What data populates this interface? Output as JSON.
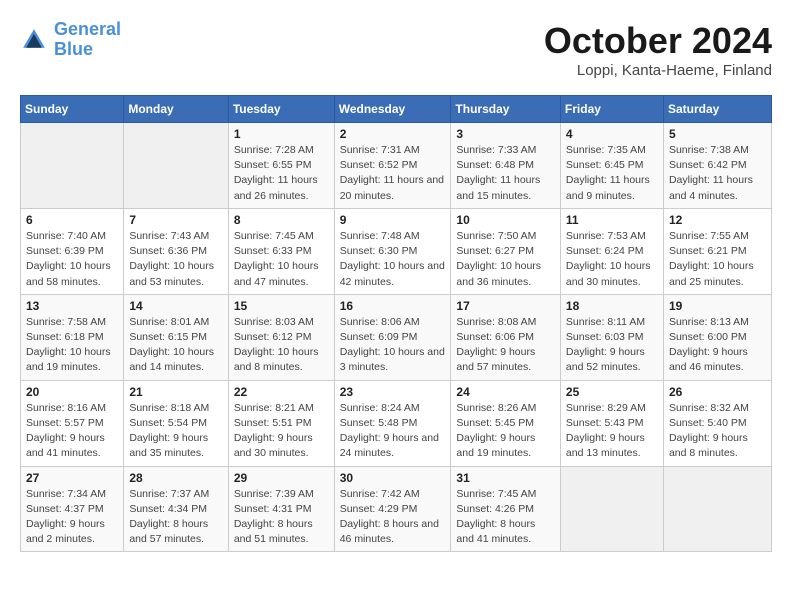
{
  "header": {
    "logo_line1": "General",
    "logo_line2": "Blue",
    "month": "October 2024",
    "location": "Loppi, Kanta-Haeme, Finland"
  },
  "weekdays": [
    "Sunday",
    "Monday",
    "Tuesday",
    "Wednesday",
    "Thursday",
    "Friday",
    "Saturday"
  ],
  "weeks": [
    [
      {
        "day": "",
        "detail": ""
      },
      {
        "day": "",
        "detail": ""
      },
      {
        "day": "1",
        "detail": "Sunrise: 7:28 AM\nSunset: 6:55 PM\nDaylight: 11 hours and 26 minutes."
      },
      {
        "day": "2",
        "detail": "Sunrise: 7:31 AM\nSunset: 6:52 PM\nDaylight: 11 hours and 20 minutes."
      },
      {
        "day": "3",
        "detail": "Sunrise: 7:33 AM\nSunset: 6:48 PM\nDaylight: 11 hours and 15 minutes."
      },
      {
        "day": "4",
        "detail": "Sunrise: 7:35 AM\nSunset: 6:45 PM\nDaylight: 11 hours and 9 minutes."
      },
      {
        "day": "5",
        "detail": "Sunrise: 7:38 AM\nSunset: 6:42 PM\nDaylight: 11 hours and 4 minutes."
      }
    ],
    [
      {
        "day": "6",
        "detail": "Sunrise: 7:40 AM\nSunset: 6:39 PM\nDaylight: 10 hours and 58 minutes."
      },
      {
        "day": "7",
        "detail": "Sunrise: 7:43 AM\nSunset: 6:36 PM\nDaylight: 10 hours and 53 minutes."
      },
      {
        "day": "8",
        "detail": "Sunrise: 7:45 AM\nSunset: 6:33 PM\nDaylight: 10 hours and 47 minutes."
      },
      {
        "day": "9",
        "detail": "Sunrise: 7:48 AM\nSunset: 6:30 PM\nDaylight: 10 hours and 42 minutes."
      },
      {
        "day": "10",
        "detail": "Sunrise: 7:50 AM\nSunset: 6:27 PM\nDaylight: 10 hours and 36 minutes."
      },
      {
        "day": "11",
        "detail": "Sunrise: 7:53 AM\nSunset: 6:24 PM\nDaylight: 10 hours and 30 minutes."
      },
      {
        "day": "12",
        "detail": "Sunrise: 7:55 AM\nSunset: 6:21 PM\nDaylight: 10 hours and 25 minutes."
      }
    ],
    [
      {
        "day": "13",
        "detail": "Sunrise: 7:58 AM\nSunset: 6:18 PM\nDaylight: 10 hours and 19 minutes."
      },
      {
        "day": "14",
        "detail": "Sunrise: 8:01 AM\nSunset: 6:15 PM\nDaylight: 10 hours and 14 minutes."
      },
      {
        "day": "15",
        "detail": "Sunrise: 8:03 AM\nSunset: 6:12 PM\nDaylight: 10 hours and 8 minutes."
      },
      {
        "day": "16",
        "detail": "Sunrise: 8:06 AM\nSunset: 6:09 PM\nDaylight: 10 hours and 3 minutes."
      },
      {
        "day": "17",
        "detail": "Sunrise: 8:08 AM\nSunset: 6:06 PM\nDaylight: 9 hours and 57 minutes."
      },
      {
        "day": "18",
        "detail": "Sunrise: 8:11 AM\nSunset: 6:03 PM\nDaylight: 9 hours and 52 minutes."
      },
      {
        "day": "19",
        "detail": "Sunrise: 8:13 AM\nSunset: 6:00 PM\nDaylight: 9 hours and 46 minutes."
      }
    ],
    [
      {
        "day": "20",
        "detail": "Sunrise: 8:16 AM\nSunset: 5:57 PM\nDaylight: 9 hours and 41 minutes."
      },
      {
        "day": "21",
        "detail": "Sunrise: 8:18 AM\nSunset: 5:54 PM\nDaylight: 9 hours and 35 minutes."
      },
      {
        "day": "22",
        "detail": "Sunrise: 8:21 AM\nSunset: 5:51 PM\nDaylight: 9 hours and 30 minutes."
      },
      {
        "day": "23",
        "detail": "Sunrise: 8:24 AM\nSunset: 5:48 PM\nDaylight: 9 hours and 24 minutes."
      },
      {
        "day": "24",
        "detail": "Sunrise: 8:26 AM\nSunset: 5:45 PM\nDaylight: 9 hours and 19 minutes."
      },
      {
        "day": "25",
        "detail": "Sunrise: 8:29 AM\nSunset: 5:43 PM\nDaylight: 9 hours and 13 minutes."
      },
      {
        "day": "26",
        "detail": "Sunrise: 8:32 AM\nSunset: 5:40 PM\nDaylight: 9 hours and 8 minutes."
      }
    ],
    [
      {
        "day": "27",
        "detail": "Sunrise: 7:34 AM\nSunset: 4:37 PM\nDaylight: 9 hours and 2 minutes."
      },
      {
        "day": "28",
        "detail": "Sunrise: 7:37 AM\nSunset: 4:34 PM\nDaylight: 8 hours and 57 minutes."
      },
      {
        "day": "29",
        "detail": "Sunrise: 7:39 AM\nSunset: 4:31 PM\nDaylight: 8 hours and 51 minutes."
      },
      {
        "day": "30",
        "detail": "Sunrise: 7:42 AM\nSunset: 4:29 PM\nDaylight: 8 hours and 46 minutes."
      },
      {
        "day": "31",
        "detail": "Sunrise: 7:45 AM\nSunset: 4:26 PM\nDaylight: 8 hours and 41 minutes."
      },
      {
        "day": "",
        "detail": ""
      },
      {
        "day": "",
        "detail": ""
      }
    ]
  ]
}
